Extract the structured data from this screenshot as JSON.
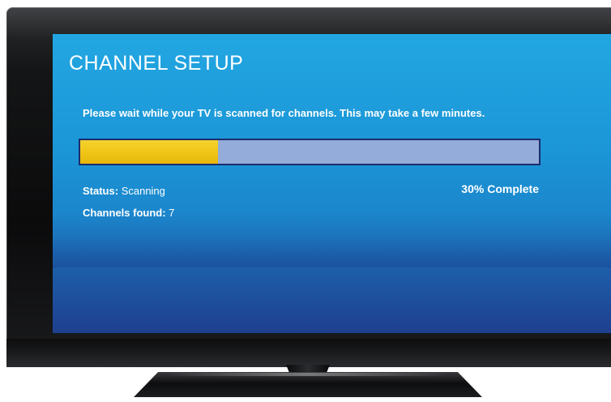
{
  "screen": {
    "title": "CHANNEL SETUP",
    "message": "Please wait while your TV is scanned for channels. This may take a few minutes.",
    "status_label": "Status:",
    "status_value": "Scanning",
    "channels_label": "Channels found:",
    "channels_value": "7",
    "percent_text": "30% Complete"
  },
  "progress": {
    "fraction": 0.3
  },
  "colors": {
    "progress_fill": "#efc315",
    "progress_track": "#93acd9",
    "screen_top": "#22a7e2",
    "screen_bottom": "#1e3f8f"
  }
}
